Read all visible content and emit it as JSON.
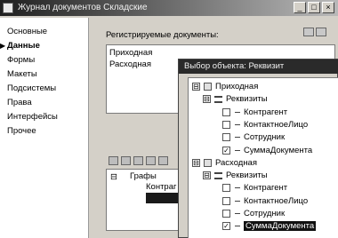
{
  "window": {
    "title": "Журнал документов Складские",
    "controls": [
      "_",
      "□",
      "×"
    ]
  },
  "nav": {
    "items": [
      "Основные",
      "Данные",
      "Формы",
      "Макеты",
      "Подсистемы",
      "Права",
      "Интерфейсы",
      "Прочее"
    ],
    "selected_index": 1,
    "marker": "▶"
  },
  "main": {
    "registered_label": "Регистрируемые документы:",
    "registered_docs": [
      "Приходная",
      "Расходная"
    ],
    "graphs_tree": {
      "root": "Графы",
      "child1": "Контраг",
      "expander": "⊟"
    }
  },
  "dialog": {
    "title": "Выбор объекта: Реквизит",
    "tree": [
      {
        "level": 0,
        "kind": "doc",
        "expander": "⊟",
        "label": "Приходная"
      },
      {
        "level": 1,
        "kind": "req",
        "expander": "⊟",
        "label": "Реквизиты"
      },
      {
        "level": 2,
        "kind": "attr",
        "checked": false,
        "label": "Контрагент"
      },
      {
        "level": 2,
        "kind": "attr",
        "checked": false,
        "label": "КонтактноеЛицо"
      },
      {
        "level": 2,
        "kind": "attr",
        "checked": false,
        "label": "Сотрудник"
      },
      {
        "level": 2,
        "kind": "attr",
        "checked": true,
        "label": "СуммаДокумента"
      },
      {
        "level": 0,
        "kind": "doc",
        "expander": "⊟",
        "label": "Расходная"
      },
      {
        "level": 1,
        "kind": "req",
        "expander": "⊟",
        "label": "Реквизиты"
      },
      {
        "level": 2,
        "kind": "attr",
        "checked": false,
        "label": "Контрагент"
      },
      {
        "level": 2,
        "kind": "attr",
        "checked": false,
        "label": "КонтактноеЛицо"
      },
      {
        "level": 2,
        "kind": "attr",
        "checked": false,
        "label": "Сотрудник"
      },
      {
        "level": 2,
        "kind": "attr",
        "checked": true,
        "label": "СуммаДокумента",
        "highlighted": true
      }
    ],
    "check_mark": "✓"
  }
}
